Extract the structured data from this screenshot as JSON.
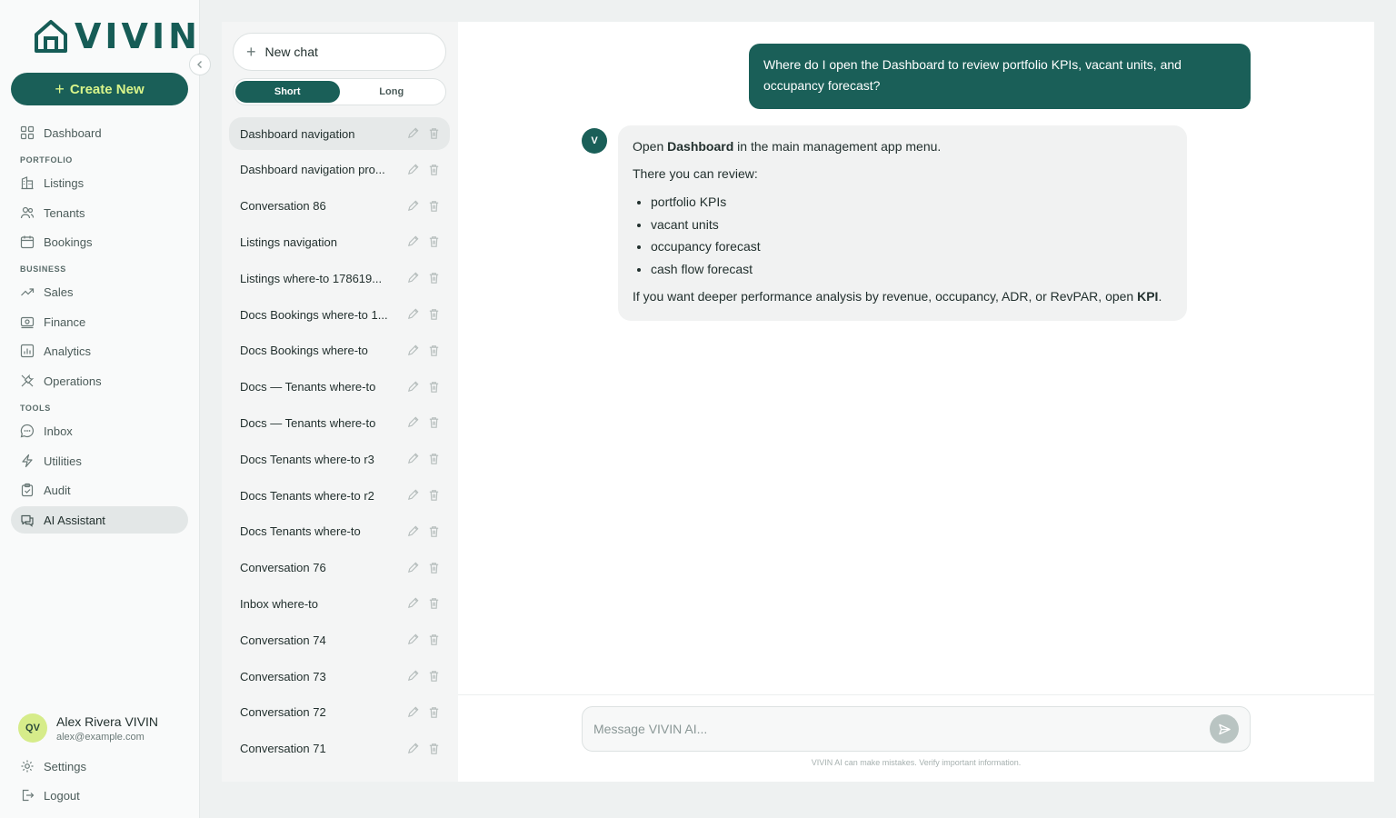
{
  "brand": {
    "name": "VIVIN"
  },
  "sidebar": {
    "create_label": "Create New",
    "items": [
      {
        "label": "Dashboard"
      },
      {
        "label": "Listings"
      },
      {
        "label": "Tenants"
      },
      {
        "label": "Bookings"
      },
      {
        "label": "Sales"
      },
      {
        "label": "Finance"
      },
      {
        "label": "Analytics"
      },
      {
        "label": "Operations"
      },
      {
        "label": "Inbox"
      },
      {
        "label": "Utilities"
      },
      {
        "label": "Audit"
      },
      {
        "label": "AI Assistant"
      }
    ],
    "sections": {
      "portfolio": "PORTFOLIO",
      "business": "BUSINESS",
      "tools": "TOOLS"
    },
    "active_item": "AI Assistant"
  },
  "user": {
    "initials": "QV",
    "name": "Alex Rivera VIVIN",
    "email": "alex@example.com"
  },
  "footer": {
    "settings": "Settings",
    "logout": "Logout"
  },
  "chats": {
    "new_chat": "New chat",
    "mode": {
      "short": "Short",
      "long": "Long",
      "selected": "Short"
    },
    "items": [
      "Dashboard navigation",
      "Dashboard navigation pro...",
      "Conversation 86",
      "Listings navigation",
      "Listings where-to 178619...",
      "Docs Bookings where-to 1...",
      "Docs Bookings where-to",
      "Docs — Tenants where-to",
      "Docs — Tenants where-to",
      "Docs Tenants where-to r3",
      "Docs Tenants where-to r2",
      "Docs Tenants where-to",
      "Conversation 76",
      "Inbox where-to",
      "Conversation 74",
      "Conversation 73",
      "Conversation 72",
      "Conversation 71"
    ]
  },
  "conversation": {
    "user_message": "Where do I open the Dashboard to review portfolio KPIs, vacant units, and occupancy forecast?",
    "assistant_initial": "V",
    "assistant": {
      "line1_pre": "Open ",
      "line1_bold": "Dashboard",
      "line1_post": " in the main management app menu.",
      "line2": "There you can review:",
      "bullets": [
        "portfolio KPIs",
        "vacant units",
        "occupancy forecast",
        "cash flow forecast"
      ],
      "line3_pre": "If you want deeper performance analysis by revenue, occupancy, ADR, or RevPAR, open ",
      "line3_bold": "KPI",
      "line3_post": "."
    }
  },
  "composer": {
    "placeholder": "Message VIVIN AI...",
    "disclaimer": "VIVIN AI can make mistakes. Verify important information."
  },
  "colors": {
    "primary": "#1a5f58",
    "accent": "#d9f58a",
    "panel": "#f4f5f5"
  }
}
